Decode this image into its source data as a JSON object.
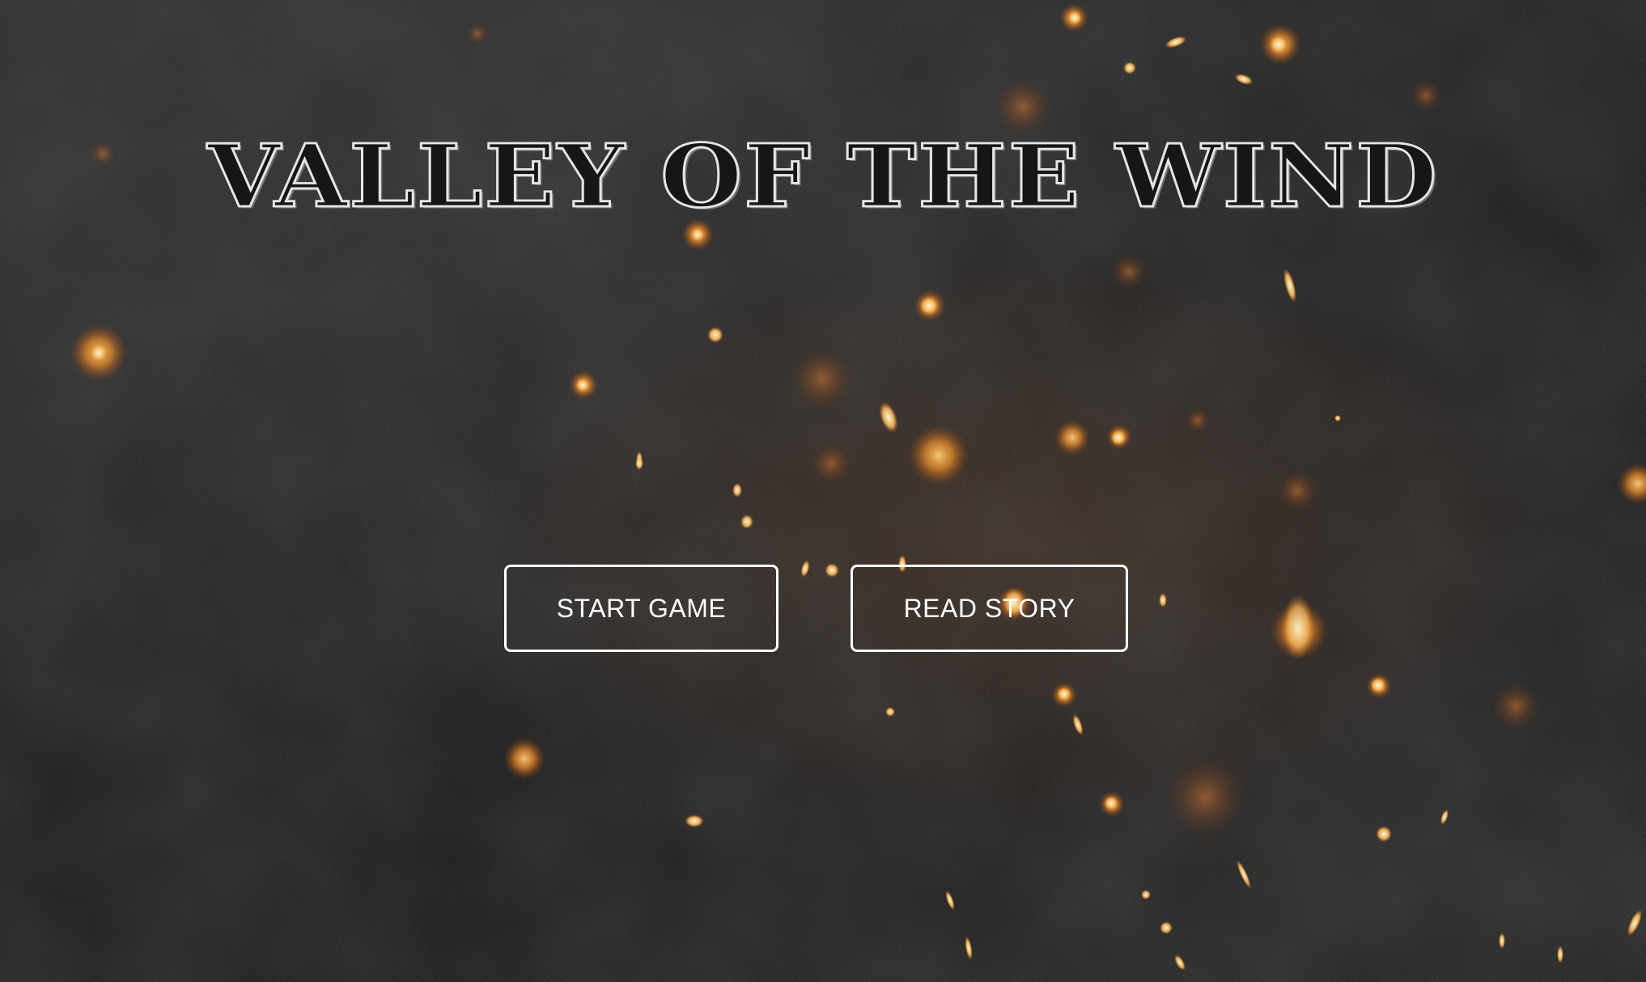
{
  "title": "VALLEY OF THE WIND",
  "menu": {
    "start_label": "START GAME",
    "story_label": "READ STORY"
  },
  "colors": {
    "background": "#121212",
    "title_outline": "#e6e6e6",
    "button_border": "#ffffff",
    "button_text": "#ffffff",
    "ember": "#f2a43a"
  }
}
